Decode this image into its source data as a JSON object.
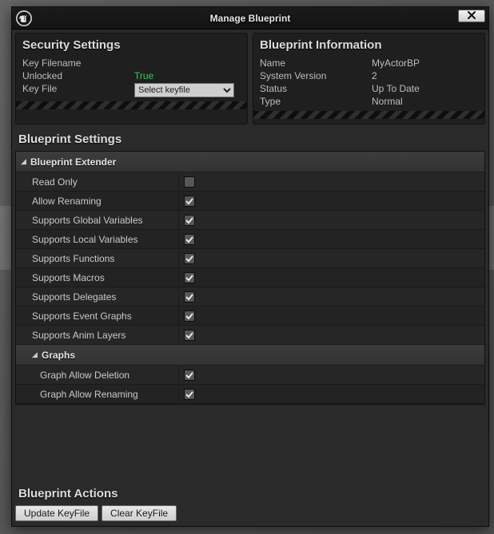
{
  "window": {
    "title": "Manage Blueprint"
  },
  "security": {
    "heading": "Security Settings",
    "key_filename_label": "Key Filename",
    "key_filename_value": "",
    "unlocked_label": "Unlocked",
    "unlocked_value": "True",
    "key_file_label": "Key File",
    "key_file_select_placeholder": "Select keyfile"
  },
  "blueprint_info": {
    "heading": "Blueprint Information",
    "name_label": "Name",
    "name_value": "MyActorBP",
    "system_version_label": "System Version",
    "system_version_value": "2",
    "status_label": "Status",
    "status_value": "Up To Date",
    "type_label": "Type",
    "type_value": "Normal"
  },
  "settings_heading": "Blueprint Settings",
  "category_extender": "Blueprint Extender",
  "category_graphs": "Graphs",
  "props": {
    "read_only": {
      "label": "Read Only",
      "checked": false
    },
    "allow_renaming": {
      "label": "Allow Renaming",
      "checked": true
    },
    "supports_global_variables": {
      "label": "Supports Global Variables",
      "checked": true
    },
    "supports_local_variables": {
      "label": "Supports Local Variables",
      "checked": true
    },
    "supports_functions": {
      "label": "Supports Functions",
      "checked": true
    },
    "supports_macros": {
      "label": "Supports Macros",
      "checked": true
    },
    "supports_delegates": {
      "label": "Supports Delegates",
      "checked": true
    },
    "supports_event_graphs": {
      "label": "Supports Event Graphs",
      "checked": true
    },
    "supports_anim_layers": {
      "label": "Supports Anim Layers",
      "checked": true
    },
    "graph_allow_deletion": {
      "label": "Graph Allow Deletion",
      "checked": true
    },
    "graph_allow_renaming": {
      "label": "Graph Allow Renaming",
      "checked": true
    }
  },
  "actions": {
    "heading": "Blueprint Actions",
    "update_keyfile": "Update KeyFile",
    "clear_keyfile": "Clear KeyFile"
  }
}
